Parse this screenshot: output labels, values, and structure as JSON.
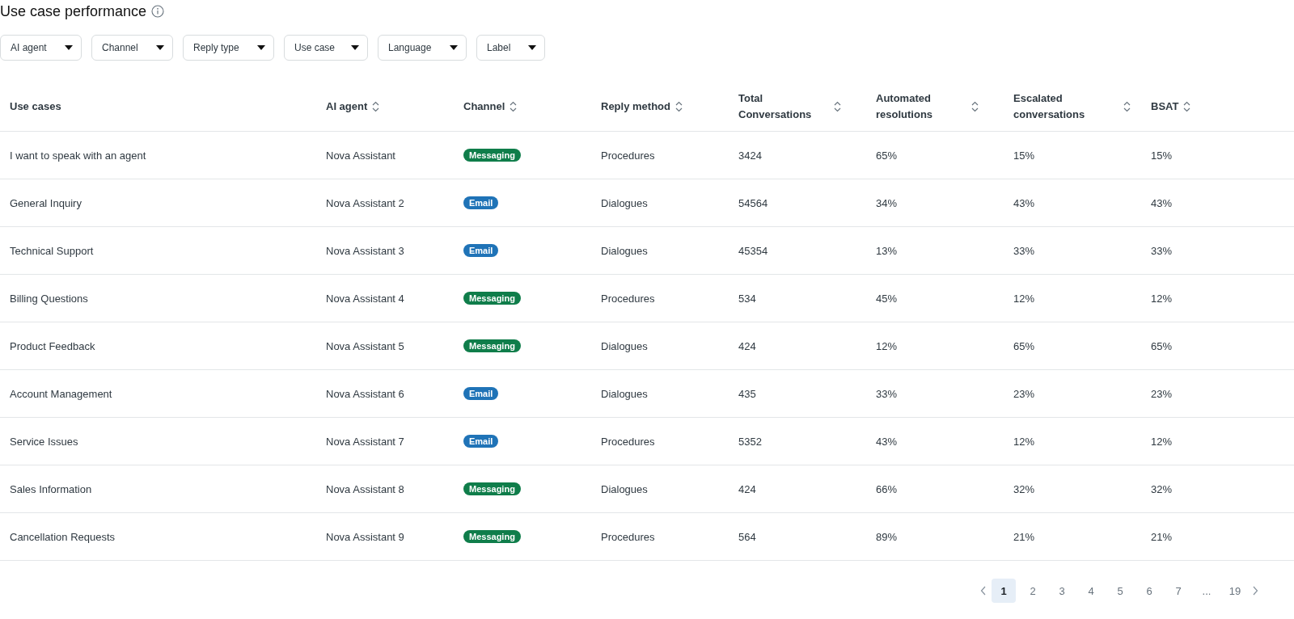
{
  "title": "Use case performance",
  "filters": [
    "AI agent",
    "Channel",
    "Reply type",
    "Use case",
    "Language",
    "Label"
  ],
  "table": {
    "columns": [
      {
        "label": "Use cases",
        "sortable": false
      },
      {
        "label": "AI agent",
        "sortable": true
      },
      {
        "label": "Channel",
        "sortable": true
      },
      {
        "label": "Reply method",
        "sortable": true
      },
      {
        "label": "Total Conversations",
        "sortable": true
      },
      {
        "label": "Automated resolutions",
        "sortable": true
      },
      {
        "label": "Escalated conversations",
        "sortable": true
      },
      {
        "label": "BSAT",
        "sortable": true
      }
    ],
    "rows": [
      {
        "use_case": "I want to speak with an agent",
        "agent": "Nova Assistant",
        "channel": {
          "label": "Messaging",
          "color": "#0f7d4a"
        },
        "reply_method": "Procedures",
        "total": "3424",
        "automated": "65%",
        "escalated": "15%",
        "bsat": "15%"
      },
      {
        "use_case": "General Inquiry",
        "agent": "Nova Assistant 2",
        "channel": {
          "label": "Email",
          "color": "#1f73b7"
        },
        "reply_method": "Dialogues",
        "total": "54564",
        "automated": "34%",
        "escalated": "43%",
        "bsat": "43%"
      },
      {
        "use_case": "Technical Support",
        "agent": "Nova Assistant 3",
        "channel": {
          "label": "Email",
          "color": "#1f73b7"
        },
        "reply_method": "Dialogues",
        "total": "45354",
        "automated": "13%",
        "escalated": "33%",
        "bsat": "33%"
      },
      {
        "use_case": "Billing Questions",
        "agent": "Nova Assistant 4",
        "channel": {
          "label": "Messaging",
          "color": "#0f7d4a"
        },
        "reply_method": "Procedures",
        "total": "534",
        "automated": "45%",
        "escalated": "12%",
        "bsat": "12%"
      },
      {
        "use_case": "Product Feedback",
        "agent": "Nova Assistant 5",
        "channel": {
          "label": "Messaging",
          "color": "#0f7d4a"
        },
        "reply_method": "Dialogues",
        "total": "424",
        "automated": "12%",
        "escalated": "65%",
        "bsat": "65%"
      },
      {
        "use_case": "Account Management",
        "agent": "Nova Assistant 6",
        "channel": {
          "label": "Email",
          "color": "#1f73b7"
        },
        "reply_method": "Dialogues",
        "total": "435",
        "automated": "33%",
        "escalated": "23%",
        "bsat": "23%"
      },
      {
        "use_case": "Service Issues",
        "agent": "Nova Assistant 7",
        "channel": {
          "label": "Email",
          "color": "#1f73b7"
        },
        "reply_method": "Procedures",
        "total": "5352",
        "automated": "43%",
        "escalated": "12%",
        "bsat": "12%"
      },
      {
        "use_case": "Sales Information",
        "agent": "Nova Assistant 8",
        "channel": {
          "label": "Messaging",
          "color": "#0f7d4a"
        },
        "reply_method": "Dialogues",
        "total": "424",
        "automated": "66%",
        "escalated": "32%",
        "bsat": "32%"
      },
      {
        "use_case": "Cancellation Requests",
        "agent": "Nova Assistant 9",
        "channel": {
          "label": "Messaging",
          "color": "#0f7d4a"
        },
        "reply_method": "Procedures",
        "total": "564",
        "automated": "89%",
        "escalated": "21%",
        "bsat": "21%"
      }
    ]
  },
  "pagination": {
    "pages": [
      {
        "label": "1",
        "kind": "page",
        "selected": true
      },
      {
        "label": "2",
        "kind": "page",
        "selected": false
      },
      {
        "label": "3",
        "kind": "page",
        "selected": false
      },
      {
        "label": "4",
        "kind": "page",
        "selected": false
      },
      {
        "label": "5",
        "kind": "page",
        "selected": false
      },
      {
        "label": "6",
        "kind": "page",
        "selected": false
      },
      {
        "label": "7",
        "kind": "page",
        "selected": false
      },
      {
        "label": "...",
        "kind": "gap"
      },
      {
        "label": "19",
        "kind": "page",
        "selected": false
      }
    ]
  }
}
